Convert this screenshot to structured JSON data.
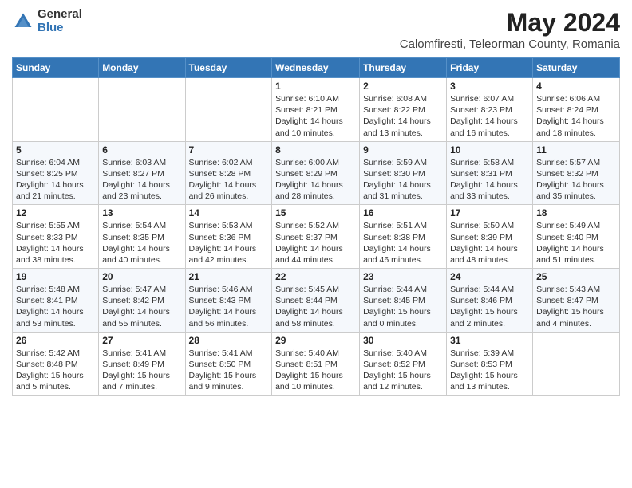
{
  "logo": {
    "general": "General",
    "blue": "Blue"
  },
  "title": "May 2024",
  "subtitle": "Calomfiresti, Teleorman County, Romania",
  "days_of_week": [
    "Sunday",
    "Monday",
    "Tuesday",
    "Wednesday",
    "Thursday",
    "Friday",
    "Saturday"
  ],
  "weeks": [
    [
      {
        "day": "",
        "sunrise": "",
        "sunset": "",
        "daylight": ""
      },
      {
        "day": "",
        "sunrise": "",
        "sunset": "",
        "daylight": ""
      },
      {
        "day": "",
        "sunrise": "",
        "sunset": "",
        "daylight": ""
      },
      {
        "day": "1",
        "sunrise": "Sunrise: 6:10 AM",
        "sunset": "Sunset: 8:21 PM",
        "daylight": "Daylight: 14 hours and 10 minutes."
      },
      {
        "day": "2",
        "sunrise": "Sunrise: 6:08 AM",
        "sunset": "Sunset: 8:22 PM",
        "daylight": "Daylight: 14 hours and 13 minutes."
      },
      {
        "day": "3",
        "sunrise": "Sunrise: 6:07 AM",
        "sunset": "Sunset: 8:23 PM",
        "daylight": "Daylight: 14 hours and 16 minutes."
      },
      {
        "day": "4",
        "sunrise": "Sunrise: 6:06 AM",
        "sunset": "Sunset: 8:24 PM",
        "daylight": "Daylight: 14 hours and 18 minutes."
      }
    ],
    [
      {
        "day": "5",
        "sunrise": "Sunrise: 6:04 AM",
        "sunset": "Sunset: 8:25 PM",
        "daylight": "Daylight: 14 hours and 21 minutes."
      },
      {
        "day": "6",
        "sunrise": "Sunrise: 6:03 AM",
        "sunset": "Sunset: 8:27 PM",
        "daylight": "Daylight: 14 hours and 23 minutes."
      },
      {
        "day": "7",
        "sunrise": "Sunrise: 6:02 AM",
        "sunset": "Sunset: 8:28 PM",
        "daylight": "Daylight: 14 hours and 26 minutes."
      },
      {
        "day": "8",
        "sunrise": "Sunrise: 6:00 AM",
        "sunset": "Sunset: 8:29 PM",
        "daylight": "Daylight: 14 hours and 28 minutes."
      },
      {
        "day": "9",
        "sunrise": "Sunrise: 5:59 AM",
        "sunset": "Sunset: 8:30 PM",
        "daylight": "Daylight: 14 hours and 31 minutes."
      },
      {
        "day": "10",
        "sunrise": "Sunrise: 5:58 AM",
        "sunset": "Sunset: 8:31 PM",
        "daylight": "Daylight: 14 hours and 33 minutes."
      },
      {
        "day": "11",
        "sunrise": "Sunrise: 5:57 AM",
        "sunset": "Sunset: 8:32 PM",
        "daylight": "Daylight: 14 hours and 35 minutes."
      }
    ],
    [
      {
        "day": "12",
        "sunrise": "Sunrise: 5:55 AM",
        "sunset": "Sunset: 8:33 PM",
        "daylight": "Daylight: 14 hours and 38 minutes."
      },
      {
        "day": "13",
        "sunrise": "Sunrise: 5:54 AM",
        "sunset": "Sunset: 8:35 PM",
        "daylight": "Daylight: 14 hours and 40 minutes."
      },
      {
        "day": "14",
        "sunrise": "Sunrise: 5:53 AM",
        "sunset": "Sunset: 8:36 PM",
        "daylight": "Daylight: 14 hours and 42 minutes."
      },
      {
        "day": "15",
        "sunrise": "Sunrise: 5:52 AM",
        "sunset": "Sunset: 8:37 PM",
        "daylight": "Daylight: 14 hours and 44 minutes."
      },
      {
        "day": "16",
        "sunrise": "Sunrise: 5:51 AM",
        "sunset": "Sunset: 8:38 PM",
        "daylight": "Daylight: 14 hours and 46 minutes."
      },
      {
        "day": "17",
        "sunrise": "Sunrise: 5:50 AM",
        "sunset": "Sunset: 8:39 PM",
        "daylight": "Daylight: 14 hours and 48 minutes."
      },
      {
        "day": "18",
        "sunrise": "Sunrise: 5:49 AM",
        "sunset": "Sunset: 8:40 PM",
        "daylight": "Daylight: 14 hours and 51 minutes."
      }
    ],
    [
      {
        "day": "19",
        "sunrise": "Sunrise: 5:48 AM",
        "sunset": "Sunset: 8:41 PM",
        "daylight": "Daylight: 14 hours and 53 minutes."
      },
      {
        "day": "20",
        "sunrise": "Sunrise: 5:47 AM",
        "sunset": "Sunset: 8:42 PM",
        "daylight": "Daylight: 14 hours and 55 minutes."
      },
      {
        "day": "21",
        "sunrise": "Sunrise: 5:46 AM",
        "sunset": "Sunset: 8:43 PM",
        "daylight": "Daylight: 14 hours and 56 minutes."
      },
      {
        "day": "22",
        "sunrise": "Sunrise: 5:45 AM",
        "sunset": "Sunset: 8:44 PM",
        "daylight": "Daylight: 14 hours and 58 minutes."
      },
      {
        "day": "23",
        "sunrise": "Sunrise: 5:44 AM",
        "sunset": "Sunset: 8:45 PM",
        "daylight": "Daylight: 15 hours and 0 minutes."
      },
      {
        "day": "24",
        "sunrise": "Sunrise: 5:44 AM",
        "sunset": "Sunset: 8:46 PM",
        "daylight": "Daylight: 15 hours and 2 minutes."
      },
      {
        "day": "25",
        "sunrise": "Sunrise: 5:43 AM",
        "sunset": "Sunset: 8:47 PM",
        "daylight": "Daylight: 15 hours and 4 minutes."
      }
    ],
    [
      {
        "day": "26",
        "sunrise": "Sunrise: 5:42 AM",
        "sunset": "Sunset: 8:48 PM",
        "daylight": "Daylight: 15 hours and 5 minutes."
      },
      {
        "day": "27",
        "sunrise": "Sunrise: 5:41 AM",
        "sunset": "Sunset: 8:49 PM",
        "daylight": "Daylight: 15 hours and 7 minutes."
      },
      {
        "day": "28",
        "sunrise": "Sunrise: 5:41 AM",
        "sunset": "Sunset: 8:50 PM",
        "daylight": "Daylight: 15 hours and 9 minutes."
      },
      {
        "day": "29",
        "sunrise": "Sunrise: 5:40 AM",
        "sunset": "Sunset: 8:51 PM",
        "daylight": "Daylight: 15 hours and 10 minutes."
      },
      {
        "day": "30",
        "sunrise": "Sunrise: 5:40 AM",
        "sunset": "Sunset: 8:52 PM",
        "daylight": "Daylight: 15 hours and 12 minutes."
      },
      {
        "day": "31",
        "sunrise": "Sunrise: 5:39 AM",
        "sunset": "Sunset: 8:53 PM",
        "daylight": "Daylight: 15 hours and 13 minutes."
      },
      {
        "day": "",
        "sunrise": "",
        "sunset": "",
        "daylight": ""
      }
    ]
  ]
}
